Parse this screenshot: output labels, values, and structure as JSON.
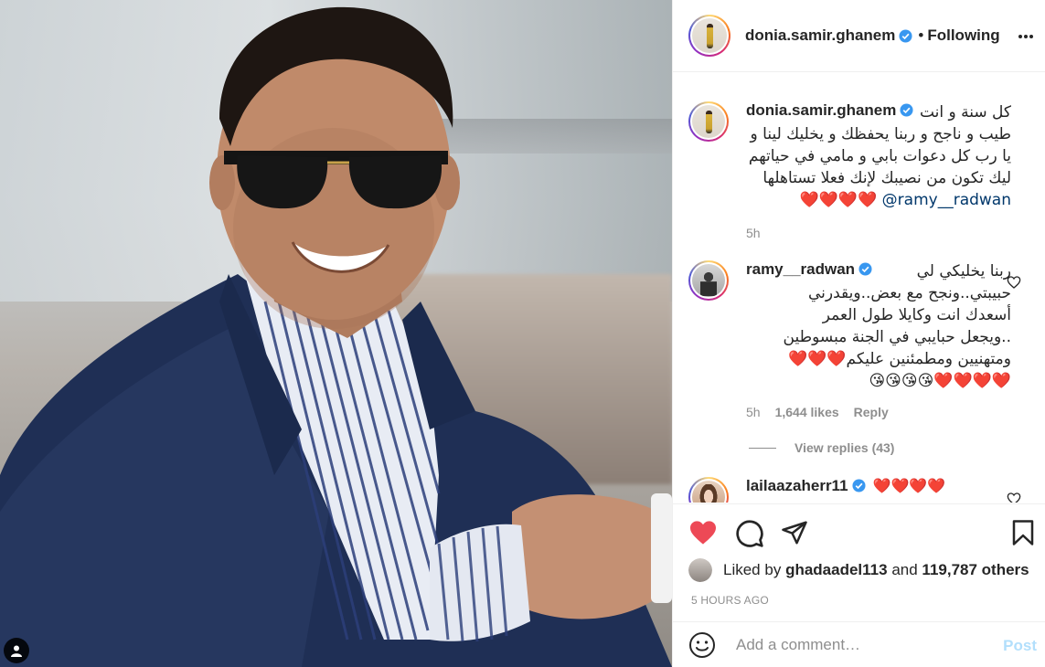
{
  "post": {
    "author": "donia.samir.ghanem",
    "follow_separator": "•",
    "follow_label": "Following",
    "likes": {
      "prefix": "Liked by",
      "user": "ghadaadel113",
      "joiner": "and",
      "others": "119,787 others"
    },
    "timestamp": "5 HOURS AGO"
  },
  "comments": [
    {
      "user": "donia.samir.ghanem",
      "first_line": "كل سنة و انت",
      "lines": [
        "طيب و ناجح و ربنا يحفظك و يخليك لينا و",
        "يا رب كل دعوات بابي و مامي في حياتهم",
        "ليك تكون من نصيبك لإنك فعلا تستاهلها"
      ],
      "hearts": "❤️❤️❤️❤️",
      "mention": "@ramy__radwan",
      "time": "5h"
    },
    {
      "user": "ramy__radwan",
      "first_line": "ربنا يخليكي لي",
      "lines": [
        "حبيبتي..ونجح مع بعض..ويقدرني",
        "أسعدك انت وكايلا طول العمر",
        "..ويجعل حبايبي في الجنة مبسوطين",
        "ومتهنيين ومطمئنين عليكم❤️❤️❤️",
        "❤️❤️❤️❤️😘😘😘😘"
      ],
      "time": "5h",
      "likes": "1,644 likes",
      "reply_label": "Reply",
      "view_replies": "View replies (43)"
    },
    {
      "user": "laila­azaherr11",
      "text": "❤️❤️❤️❤️"
    }
  ],
  "add_comment": {
    "placeholder": "Add a comment…",
    "post_label": "Post"
  },
  "colors": {
    "like_red": "#ed4956",
    "link_blue": "#00376b",
    "verified_blue": "#3897f0",
    "post_disabled": "#b2dffc"
  }
}
